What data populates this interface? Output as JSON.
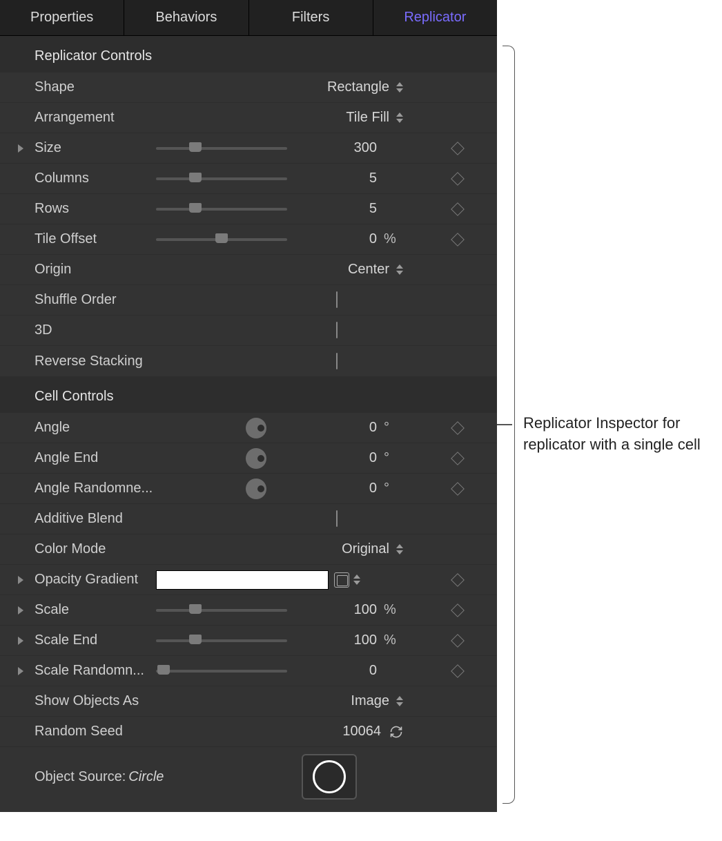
{
  "tabs": {
    "properties": "Properties",
    "behaviors": "Behaviors",
    "filters": "Filters",
    "replicator": "Replicator"
  },
  "sections": {
    "replicator_controls": "Replicator Controls",
    "cell_controls": "Cell Controls"
  },
  "params": {
    "shape": {
      "label": "Shape",
      "value": "Rectangle"
    },
    "arrangement": {
      "label": "Arrangement",
      "value": "Tile Fill"
    },
    "size": {
      "label": "Size",
      "value": "300",
      "slider_pct": 30
    },
    "columns": {
      "label": "Columns",
      "value": "5",
      "slider_pct": 30
    },
    "rows": {
      "label": "Rows",
      "value": "5",
      "slider_pct": 30
    },
    "tile_offset": {
      "label": "Tile Offset",
      "value": "0",
      "unit": "%",
      "slider_pct": 50
    },
    "origin": {
      "label": "Origin",
      "value": "Center"
    },
    "shuffle_order": {
      "label": "Shuffle Order"
    },
    "three_d": {
      "label": "3D"
    },
    "reverse_stacking": {
      "label": "Reverse Stacking"
    },
    "angle": {
      "label": "Angle",
      "value": "0",
      "unit": "°"
    },
    "angle_end": {
      "label": "Angle End",
      "value": "0",
      "unit": "°"
    },
    "angle_randomness": {
      "label": "Angle Randomne...",
      "value": "0",
      "unit": "°"
    },
    "additive_blend": {
      "label": "Additive Blend"
    },
    "color_mode": {
      "label": "Color Mode",
      "value": "Original"
    },
    "opacity_gradient": {
      "label": "Opacity Gradient"
    },
    "scale": {
      "label": "Scale",
      "value": "100",
      "unit": "%",
      "slider_pct": 30
    },
    "scale_end": {
      "label": "Scale End",
      "value": "100",
      "unit": "%",
      "slider_pct": 30
    },
    "scale_randomness": {
      "label": "Scale Randomn...",
      "value": "0",
      "slider_pct": 6
    },
    "show_objects_as": {
      "label": "Show Objects As",
      "value": "Image"
    },
    "random_seed": {
      "label": "Random Seed",
      "value": "10064"
    },
    "object_source": {
      "label": "Object Source:",
      "name": "Circle"
    }
  },
  "callout": "Replicator Inspector for replicator with a single cell"
}
